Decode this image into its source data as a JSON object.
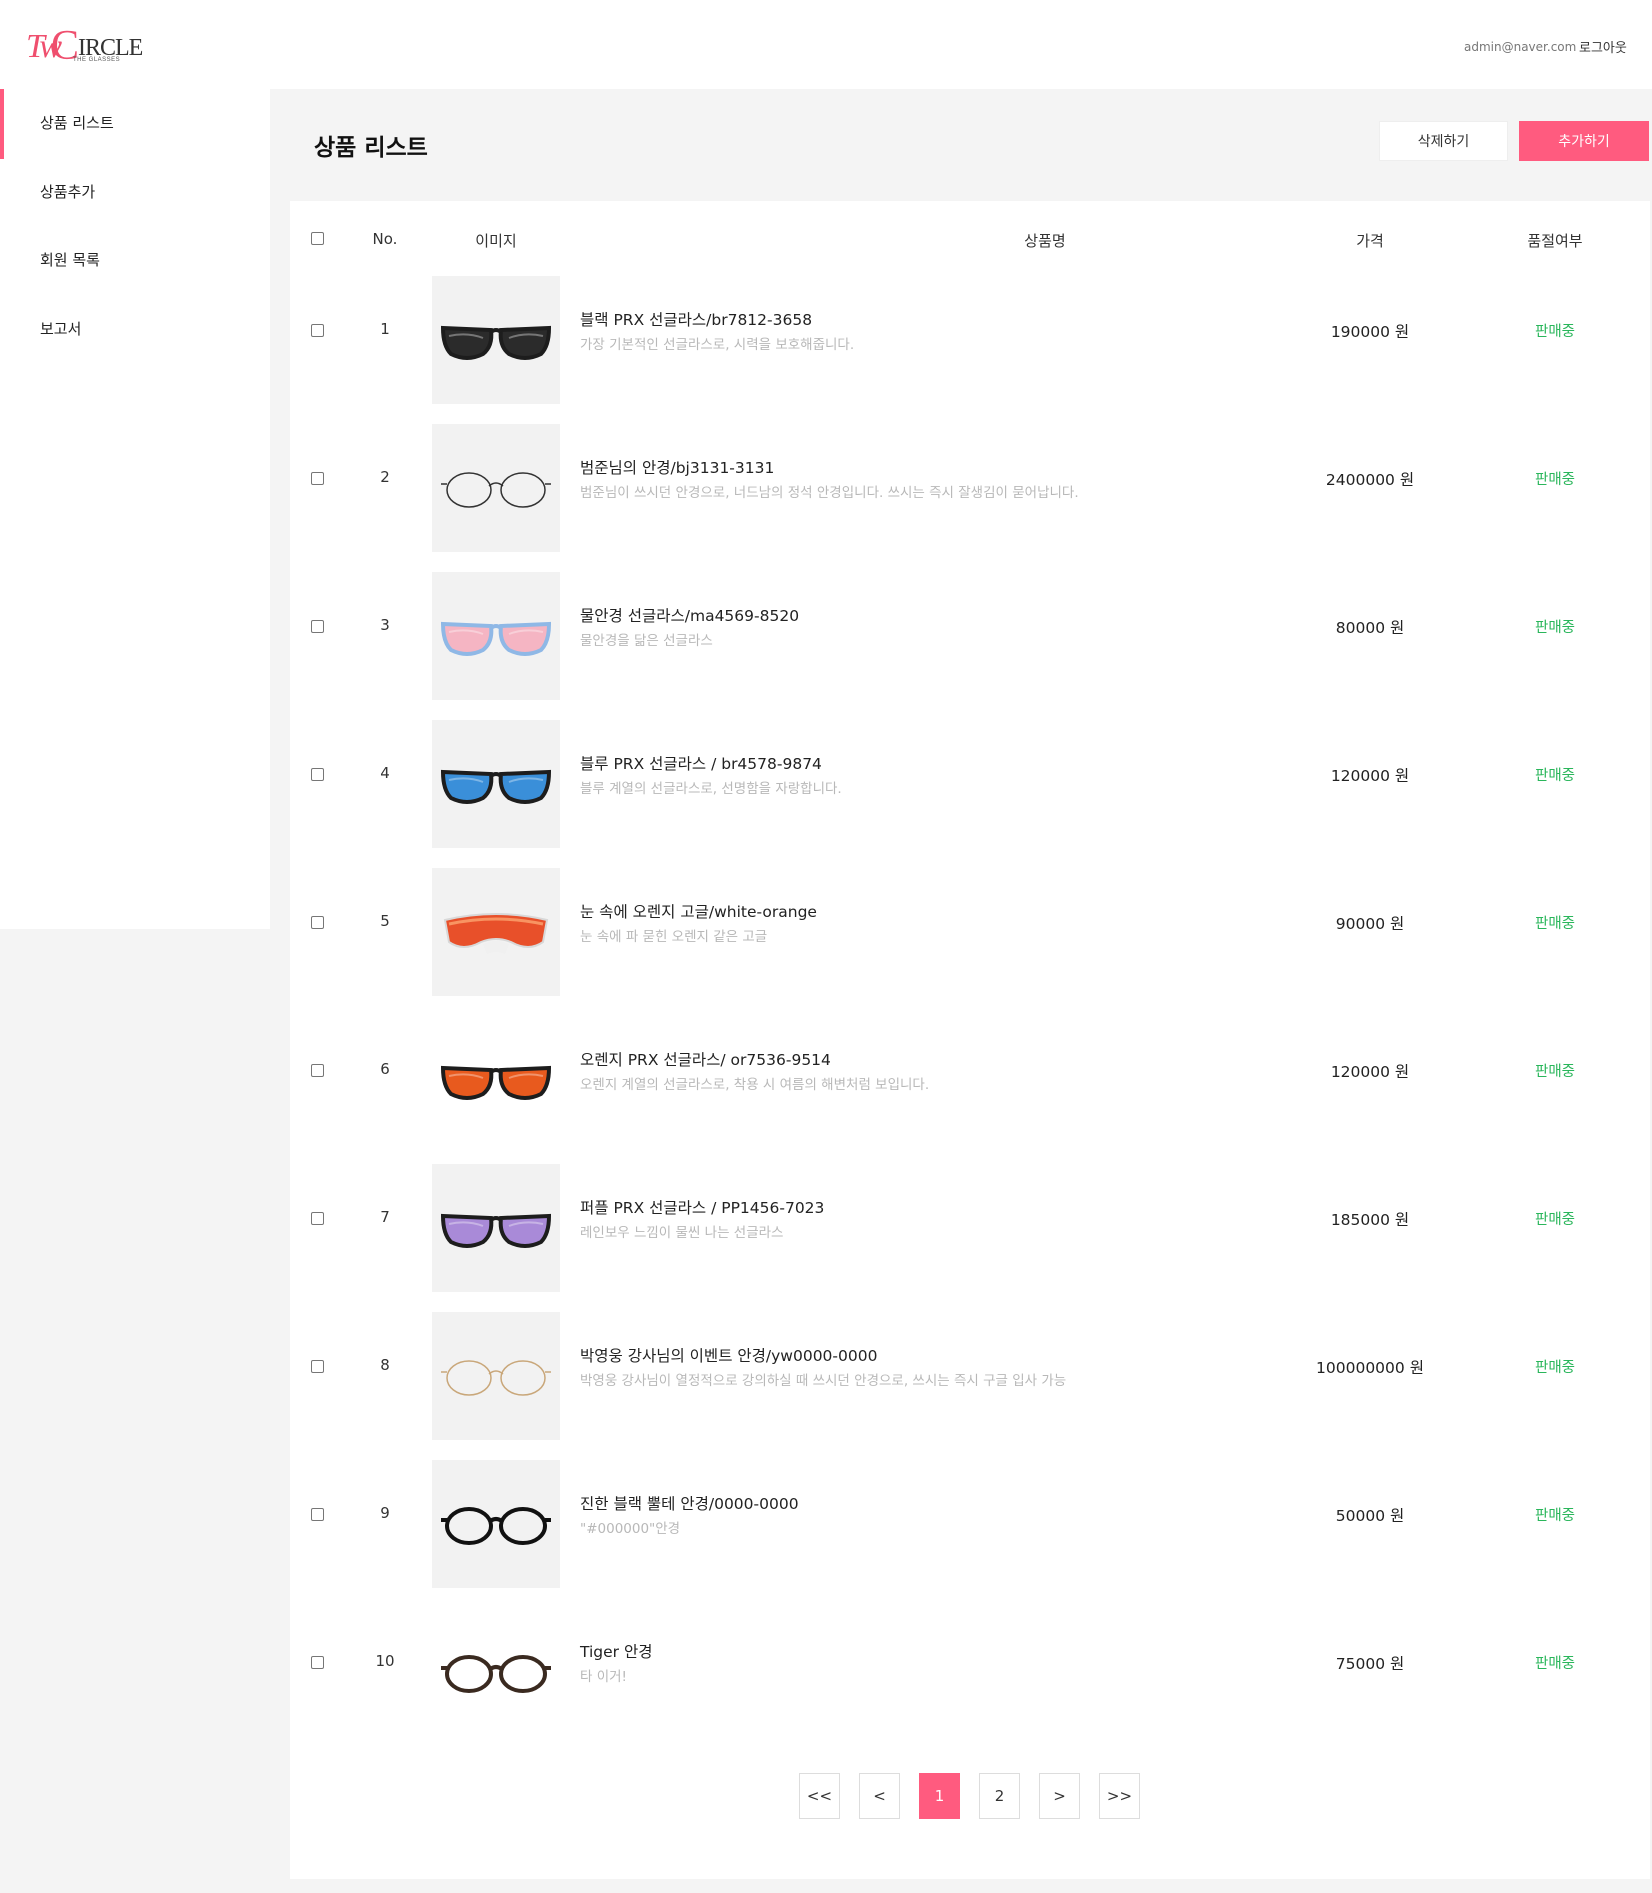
{
  "header": {
    "logo": {
      "mark": "TwoCIRCLE",
      "sub": "THE GLASSES"
    },
    "user_email": "admin@naver.com",
    "logout_label": "로그아웃"
  },
  "sidebar": {
    "items": [
      {
        "label": "상품 리스트",
        "active": true
      },
      {
        "label": "상품추가",
        "active": false
      },
      {
        "label": "회원 목록",
        "active": false
      },
      {
        "label": "보고서",
        "active": false
      }
    ]
  },
  "main": {
    "title": "상품 리스트",
    "delete_label": "삭제하기",
    "add_label": "추가하기",
    "columns": {
      "no": "No.",
      "image": "이미지",
      "name": "상품명",
      "price": "가격",
      "status": "품절여부"
    },
    "products": [
      {
        "no": "1",
        "name": "블랙 PRX 선글라스/br7812-3658",
        "desc": "가장 기본적인 선글라스로, 시력을 보호해줍니다.",
        "price": "190000 원",
        "status": "판매중",
        "image": "black-sport-sunglasses",
        "lens": "#2b2b2b",
        "frame": "#1d1d1d"
      },
      {
        "no": "2",
        "name": "범준님의 안경/bj3131-3131",
        "desc": "범준님이 쓰시던 안경으로, 너드남의 정석 안경입니다. 쓰시는 즉시 잘생김이 묻어납니다.",
        "price": "2400000 원",
        "status": "판매중",
        "image": "round-wire-glasses",
        "lens": "none",
        "frame": "#333333"
      },
      {
        "no": "3",
        "name": "물안경 선글라스/ma4569-8520",
        "desc": "물안경을 닮은 선글라스",
        "price": "80000 원",
        "status": "판매중",
        "image": "pink-lens-sunglasses",
        "lens": "#f5b5c3",
        "frame": "#8fb8e6"
      },
      {
        "no": "4",
        "name": "블루 PRX 선글라스 / br4578-9874",
        "desc": "블루 계열의 선글라스로, 선명함을 자랑합니다.",
        "price": "120000 원",
        "status": "판매중",
        "image": "blue-sport-sunglasses",
        "lens": "#3a8fd9",
        "frame": "#1d1d1d"
      },
      {
        "no": "5",
        "name": "눈 속에 오렌지 고글/white-orange",
        "desc": "눈 속에 파 묻힌 오렌지 같은 고글",
        "price": "90000 원",
        "status": "판매중",
        "image": "orange-goggle",
        "lens": "#e8502a",
        "frame": "#f2f2f2"
      },
      {
        "no": "6",
        "name": "오렌지 PRX 선글라스/ or7536-9514",
        "desc": "오렌지 계열의 선글라스로, 착용 시 여름의 해변처럼 보입니다.",
        "price": "120000 원",
        "status": "판매중",
        "image": "orange-sport-sunglasses",
        "lens": "#e85a1e",
        "frame": "#1d1d1d"
      },
      {
        "no": "7",
        "name": "퍼플 PRX 선글라스 / PP1456-7023",
        "desc": "레인보우 느낌이 물씬 나는 선글라스",
        "price": "185000 원",
        "status": "판매중",
        "image": "purple-sport-sunglasses",
        "lens": "#a98ad8",
        "frame": "#1d1d1d"
      },
      {
        "no": "8",
        "name": "박영웅 강사님의 이벤트 안경/yw0000-0000",
        "desc": "박영웅 강사님이 열정적으로 강의하실 때 쓰시던 안경으로, 쓰시는 즉시 구글 입사 가능",
        "price": "100000000 원",
        "status": "판매중",
        "image": "gold-wire-glasses",
        "lens": "none",
        "frame": "#c9a77a"
      },
      {
        "no": "9",
        "name": "진한 블랙 뿔테 안경/0000-0000",
        "desc": "\"#000000\"안경",
        "price": "50000 원",
        "status": "판매중",
        "image": "black-horn-glasses",
        "lens": "none",
        "frame": "#111111"
      },
      {
        "no": "10",
        "name": "Tiger 안경",
        "desc": "타 이거!",
        "price": "75000 원",
        "status": "판매중",
        "image": "brown-horn-glasses",
        "lens": "none",
        "frame": "#3a2a20"
      }
    ]
  },
  "pagination": {
    "first": "<<",
    "prev": "<",
    "pages": [
      "1",
      "2"
    ],
    "current": "1",
    "next": ">",
    "last": ">>"
  }
}
